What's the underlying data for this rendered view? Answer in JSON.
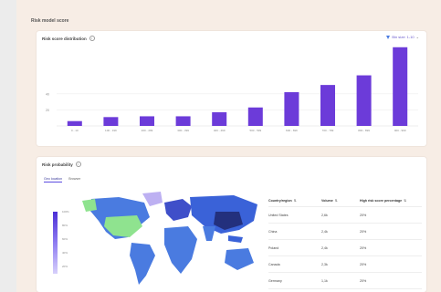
{
  "frame": {
    "title": "Risk model score"
  },
  "bar_card": {
    "title": "Risk score distribution",
    "filter_label": "Bin size: 1-10"
  },
  "map_card": {
    "title": "Risk probability",
    "tabs": [
      "Geo location",
      "Browser"
    ],
    "legend_labels": [
      "100%",
      "80%",
      "60%",
      "40%",
      "20%",
      "0%"
    ],
    "table": {
      "headers": [
        "Country/region",
        "Volume",
        "High risk score percentage"
      ],
      "rows": [
        [
          "United States",
          "2,6k",
          "20%"
        ],
        [
          "China",
          "2,4k",
          "20%"
        ],
        [
          "Poland",
          "2,4k",
          "20%"
        ],
        [
          "Canada",
          "2,3k",
          "20%"
        ],
        [
          "Germany",
          "1,1k",
          "20%"
        ]
      ]
    }
  },
  "chart_data": {
    "type": "bar",
    "categories": [
      "0 - 10",
      "100 - 199",
      "200 - 299",
      "300 - 399",
      "400 - 499",
      "500 - 599",
      "600 - 699",
      "700 - 799",
      "800 - 899",
      "900 - 999"
    ],
    "values": [
      6,
      11,
      12,
      12,
      17,
      23,
      42,
      51,
      63,
      98
    ],
    "yticks": [
      20,
      40
    ],
    "ylim": [
      0,
      100
    ],
    "colors": {
      "bar": "#6c3bd9"
    }
  }
}
